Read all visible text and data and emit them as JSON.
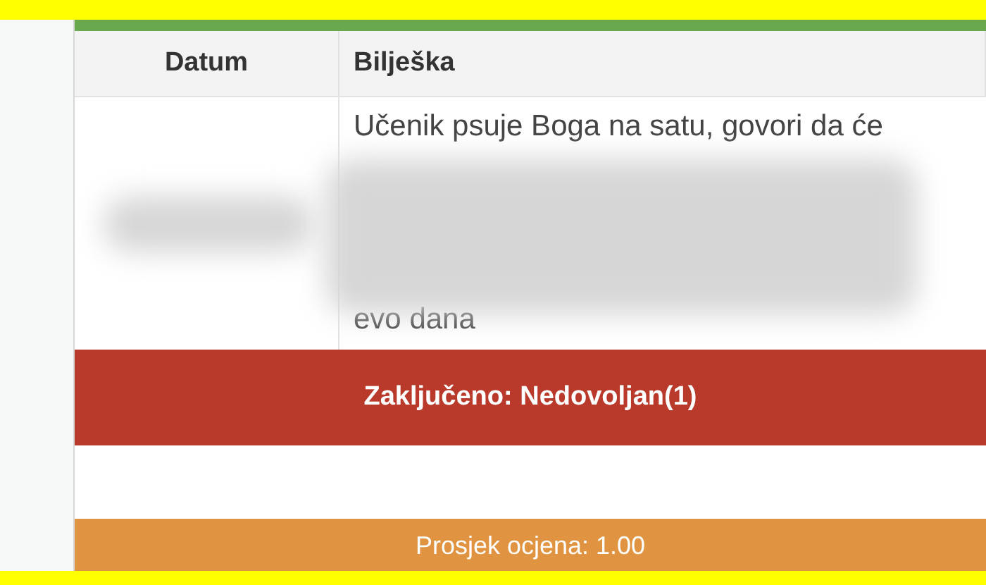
{
  "table": {
    "columns": [
      "Datum",
      "Bilješka"
    ],
    "rows": [
      {
        "note_lines": [
          "Učenik psuje Boga na satu, govori da će",
          "evo dana"
        ]
      }
    ]
  },
  "final_grade": "Zaključeno: Nedovoljan(1)",
  "average": "Prosjek ocjena: 1.00"
}
